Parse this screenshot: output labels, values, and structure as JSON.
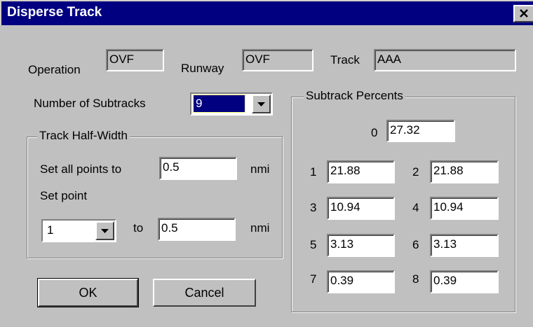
{
  "window": {
    "title": "Disperse Track",
    "close_icon": "close-icon"
  },
  "header": {
    "operation_label": "Operation",
    "operation_value": "OVF",
    "runway_label": "Runway",
    "runway_value": "OVF",
    "track_label": "Track",
    "track_value": "AAA"
  },
  "subtracks": {
    "label": "Number of Subtracks",
    "selected": "9"
  },
  "half_width": {
    "group_title": "Track Half-Width",
    "set_all_label": "Set all points to",
    "set_all_value": "0.5",
    "set_all_unit": "nmi",
    "set_point_label": "Set point",
    "point_selected": "1",
    "to_label": "to",
    "point_value": "0.5",
    "point_unit": "nmi"
  },
  "percents": {
    "group_title": "Subtrack Percents",
    "items": [
      {
        "index": "0",
        "value": "27.32"
      },
      {
        "index": "1",
        "value": "21.88"
      },
      {
        "index": "2",
        "value": "21.88"
      },
      {
        "index": "3",
        "value": "10.94"
      },
      {
        "index": "4",
        "value": "10.94"
      },
      {
        "index": "5",
        "value": "3.13"
      },
      {
        "index": "6",
        "value": "3.13"
      },
      {
        "index": "7",
        "value": "0.39"
      },
      {
        "index": "8",
        "value": "0.39"
      }
    ]
  },
  "buttons": {
    "ok_label": "OK",
    "cancel_label": "Cancel"
  },
  "colors": {
    "titlebar": "#000080",
    "face": "#c0c0c0"
  }
}
